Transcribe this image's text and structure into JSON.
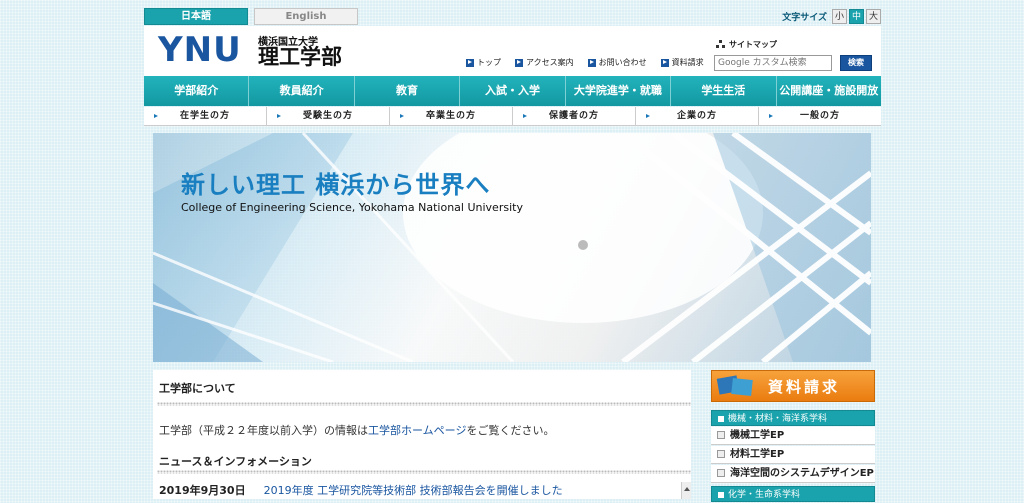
{
  "lang": {
    "japanese": "日本語",
    "english": "English"
  },
  "fontsize": {
    "label": "文字サイズ",
    "small": "小",
    "medium": "中",
    "large": "大"
  },
  "header": {
    "logo_mark": "YNU",
    "university": "横浜国立大学",
    "faculty": "理工学部",
    "links": [
      "トップ",
      "アクセス案内",
      "お問い合わせ",
      "資料請求"
    ],
    "sitemap": "サイトマップ",
    "search_placeholder": "Google カスタム検索",
    "search_button": "検索"
  },
  "mainnav": [
    "学部紹介",
    "教員紹介",
    "教育",
    "入試・入学",
    "大学院進学・就職",
    "学生生活",
    "公開講座・施設開放"
  ],
  "subnav": [
    "在学生の方",
    "受験生の方",
    "卒業生の方",
    "保護者の方",
    "企業の方",
    "一般の方"
  ],
  "hero": {
    "title": "新しい理工 横浜から世界へ",
    "subtitle": "College of Engineering Science, Yokohama National University"
  },
  "content": {
    "section_title": "工学部について",
    "intro_before": "工学部（平成２２年度以前入学）の情報は",
    "intro_link": "工学部ホームページ",
    "intro_after": "をご覧ください。",
    "news_title": "ニュース＆インフォメーション",
    "news": [
      {
        "date": "2019年9月30日",
        "text": "2019年度 工学研究院等技術部 技術部報告会を開催しました"
      }
    ]
  },
  "side": {
    "request_label": "資料請求",
    "departments": [
      {
        "heading": "機械・材料・海洋系学科",
        "items": [
          "機械工学EP",
          "材料工学EP",
          "海洋空間のシステムデザインEP"
        ]
      },
      {
        "heading": "化学・生命系学科",
        "items": []
      }
    ]
  },
  "colors": {
    "teal": "#1aa3ac",
    "blue": "#1a56a0",
    "orange": "#ea7c10",
    "hero_text": "#1a7fc0"
  }
}
